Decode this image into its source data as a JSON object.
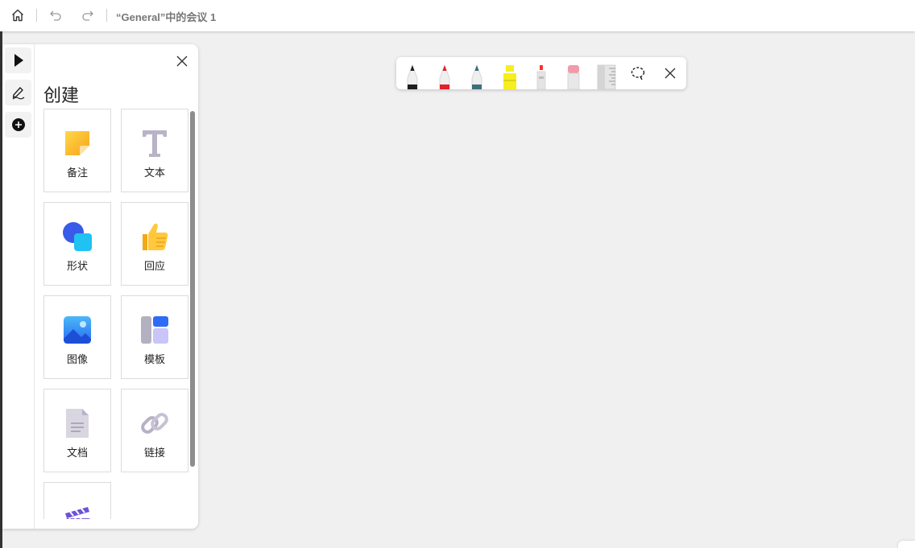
{
  "header": {
    "title": "“General”中的会议 1",
    "icons": [
      "home-icon",
      "undo-icon",
      "redo-icon"
    ]
  },
  "rail": {
    "items": [
      "select-pointer-icon",
      "pen-draw-icon",
      "add-circle-icon"
    ]
  },
  "panel": {
    "title": "创建",
    "tiles": [
      {
        "label": "备注",
        "icon": "sticky-note-icon"
      },
      {
        "label": "文本",
        "icon": "text-icon"
      },
      {
        "label": "形状",
        "icon": "shapes-icon"
      },
      {
        "label": "回应",
        "icon": "thumbs-up-icon"
      },
      {
        "label": "图像",
        "icon": "image-icon"
      },
      {
        "label": "模板",
        "icon": "template-icon"
      },
      {
        "label": "文档",
        "icon": "document-icon"
      },
      {
        "label": "链接",
        "icon": "link-icon"
      },
      {
        "label": "",
        "icon": "clapperboard-icon"
      }
    ]
  },
  "pen_toolbar": {
    "tools": [
      {
        "name": "black-pen-icon",
        "color": "#1e1e1e"
      },
      {
        "name": "red-pen-icon",
        "color": "#e0202a"
      },
      {
        "name": "teal-pen-icon",
        "color": "#3d6f7a"
      },
      {
        "name": "yellow-highlighter-icon",
        "color": "#f6ee1e"
      },
      {
        "name": "laser-pointer-icon",
        "color": "#ff3030"
      },
      {
        "name": "eraser-icon",
        "color": "#f19aa8"
      },
      {
        "name": "ruler-icon",
        "color": "#c8c8c8"
      }
    ],
    "extra": [
      "lasso-select-icon",
      "close-icon"
    ]
  },
  "colors": {
    "canvas": "#f0f0f0",
    "panel": "#ffffff",
    "accent_blue": "#2f6cf6"
  }
}
